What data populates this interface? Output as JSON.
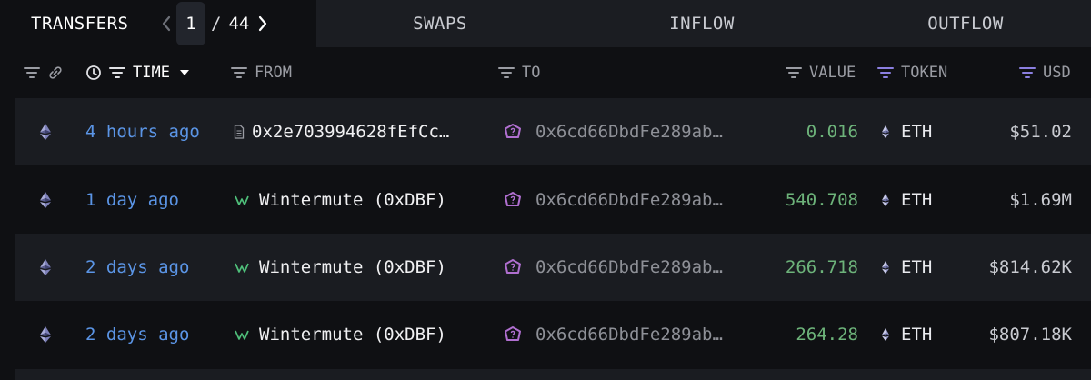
{
  "tabs": {
    "transfers": "TRANSFERS",
    "swaps": "SWAPS",
    "inflow": "INFLOW",
    "outflow": "OUTFLOW"
  },
  "pager": {
    "current": "1",
    "separator": "/",
    "total": "44"
  },
  "columns": {
    "time": "TIME",
    "from": "FROM",
    "to": "TO",
    "value": "VALUE",
    "token": "TOKEN",
    "usd": "USD"
  },
  "rows": [
    {
      "time": "4 hours ago",
      "from": "0x2e703994628fEfCc…",
      "from_icon": "document-icon",
      "to": "0x6cd66DbdFe289ab…",
      "value": "0.016",
      "token": "ETH",
      "usd": "$51.02"
    },
    {
      "time": "1 day ago",
      "from": "Wintermute (0xDBF)",
      "from_icon": "wintermute-icon",
      "to": "0x6cd66DbdFe289ab…",
      "value": "540.708",
      "token": "ETH",
      "usd": "$1.69M"
    },
    {
      "time": "2 days ago",
      "from": "Wintermute (0xDBF)",
      "from_icon": "wintermute-icon",
      "to": "0x6cd66DbdFe289ab…",
      "value": "266.718",
      "token": "ETH",
      "usd": "$814.62K"
    },
    {
      "time": "2 days ago",
      "from": "Wintermute (0xDBF)",
      "from_icon": "wintermute-icon",
      "to": "0x6cd66DbdFe289ab…",
      "value": "264.28",
      "token": "ETH",
      "usd": "$807.18K"
    }
  ],
  "colors": {
    "time_link": "#5b95e6",
    "value_green": "#6db37a",
    "token_filter_purple": "#8b7fe0",
    "to_entity_pink": "#b06fd0"
  }
}
